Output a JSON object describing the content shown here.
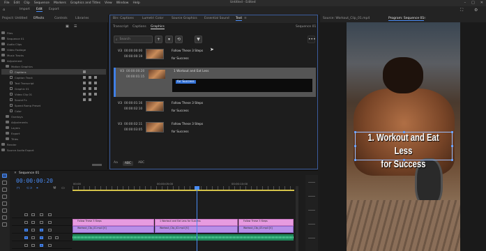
{
  "menubar": {
    "items": [
      "File",
      "Edit",
      "Clip",
      "Sequence",
      "Markers",
      "Graphics and Titles",
      "View",
      "Window",
      "Help"
    ],
    "title": "Untitled - Edited"
  },
  "workspace": {
    "tabs": [
      "Import",
      "Edit",
      "Export"
    ]
  },
  "project": {
    "tabs": [
      "Project: Untitled",
      "Effects",
      "Controls",
      "Libraries"
    ],
    "rows": [
      "Files",
      "Sequence 01",
      "Audio Clips",
      "Video Footage",
      "Music Tracks",
      "Adjustment",
      "Motion Graphics",
      "Captions",
      "Caption Track",
      "Text Transcript",
      "Graphic 01",
      "Video Clip 01",
      "Sound Fx",
      "Speed Ramp Preset",
      "Color",
      "Overlays",
      "Adjustments",
      "Layers",
      "Export",
      "Titles",
      "Render",
      "Source Audio Export"
    ]
  },
  "graphics": {
    "tabs": [
      "Bin: Captions",
      "Lumetri Color",
      "Source Graphics",
      "Essential Sound",
      "Text"
    ],
    "subtabs": [
      "Transcript",
      "Captions",
      "Graphics"
    ],
    "sequence": "Sequence 01",
    "search_placeholder": "Search",
    "buttons": [
      "+",
      "▾",
      "⟲",
      "▼"
    ],
    "more": "•••",
    "captions": [
      {
        "track": "V3",
        "tc_in": "00:00:00:00",
        "tc_out": "00:00:00:19",
        "text1": "Follow These 3 Steps",
        "text2": "for Success"
      },
      {
        "track": "V3",
        "tc_in": "00:00:00:20",
        "tc_out": "00:00:01:15",
        "text1": "1 Workout and Eat Less",
        "text2": "",
        "edit": "for Success"
      },
      {
        "track": "V3",
        "tc_in": "00:00:01:16",
        "tc_out": "00:00:02:10",
        "text1": "Follow These 3 Steps",
        "text2": "for Success"
      },
      {
        "track": "V3",
        "tc_in": "00:00:02:11",
        "tc_out": "00:00:03:05",
        "text1": "Follow These 3 Steps",
        "text2": "for Success"
      }
    ],
    "footer": [
      "Aa",
      "ABC",
      "ABC"
    ]
  },
  "monitor": {
    "tabs": [
      "Source: Workout_Clip_01.mp4",
      "Program: Sequence 01"
    ],
    "caption_line1": "1. Workout and Eat Less",
    "caption_line2": "for Success"
  },
  "timeline": {
    "tab": "Sequence 01",
    "timecode": "00:00:00:20",
    "ruler_tcs": [
      "00:00",
      "00:00:05:00",
      "00:00:10:00"
    ],
    "clips_v3": [
      "Follow These 3 Steps",
      "1 Workout and Eat Less for Success",
      "Follow These 3 Steps"
    ],
    "clips_v2": [
      "Workout_Clip_01.mp4 [V]",
      "Workout_Clip_02.mp4 [V]",
      "Workout_Clip_03.mp4 [V]"
    ]
  }
}
